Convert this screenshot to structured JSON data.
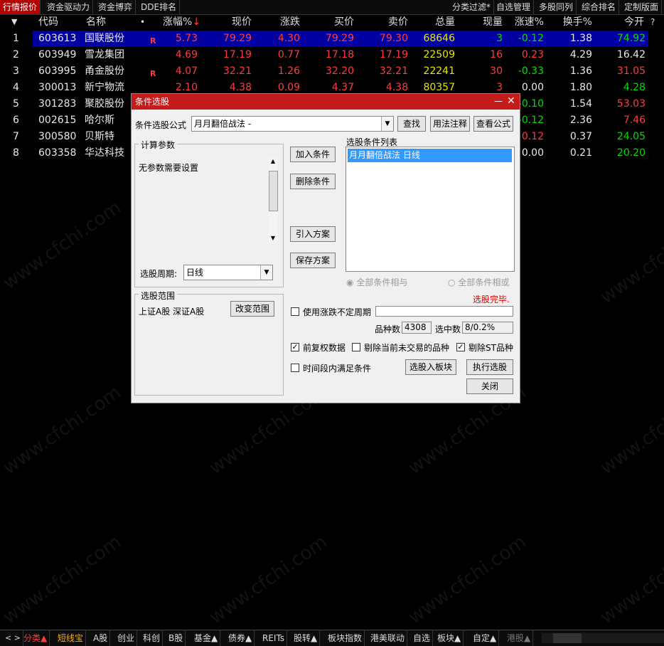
{
  "top_tabs": [
    "行情报价",
    "资金驱动力",
    "资金博弈",
    "DDE排名"
  ],
  "top_right_tabs": [
    "分类过滤*",
    "自选管理",
    "多股同列",
    "综合排名",
    "定制版面"
  ],
  "headers": {
    "arrow": "▼",
    "code": "代码",
    "name": "名称",
    "dot": "•",
    "chg_pct": "涨幅%",
    "chg_arrow": "↓",
    "price": "现价",
    "chg": "涨跌",
    "bid": "买价",
    "ask": "卖价",
    "vol": "总量",
    "cur_vol": "现量",
    "speed": "涨速%",
    "turnover": "换手%",
    "open": "今开",
    "help": "?"
  },
  "rows": [
    {
      "idx": "1",
      "code": "603613",
      "name": "国联股份",
      "flag": "R",
      "chg_pct": "5.73",
      "price": "79.29",
      "chg": "4.30",
      "bid": "79.29",
      "ask": "79.30",
      "vol": "68646",
      "cur_vol": "3",
      "speed": "-0.12",
      "turnover": "1.38",
      "open": "74.92"
    },
    {
      "idx": "2",
      "code": "603949",
      "name": "雪龙集团",
      "flag": "",
      "chg_pct": "4.69",
      "price": "17.19",
      "chg": "0.77",
      "bid": "17.18",
      "ask": "17.19",
      "vol": "22509",
      "cur_vol": "16",
      "speed": "0.23",
      "turnover": "4.29",
      "open": "16.42"
    },
    {
      "idx": "3",
      "code": "603995",
      "name": "甬金股份",
      "flag": "R",
      "chg_pct": "4.07",
      "price": "32.21",
      "chg": "1.26",
      "bid": "32.20",
      "ask": "32.21",
      "vol": "22241",
      "cur_vol": "30",
      "speed": "-0.33",
      "turnover": "1.36",
      "open": "31.05"
    },
    {
      "idx": "4",
      "code": "300013",
      "name": "新宁物流",
      "flag": "",
      "chg_pct": "2.10",
      "price": "4.38",
      "chg": "0.09",
      "bid": "4.37",
      "ask": "4.38",
      "vol": "80357",
      "cur_vol": "3",
      "speed": "0.00",
      "turnover": "1.80",
      "open": "4.28"
    },
    {
      "idx": "5",
      "code": "301283",
      "name": "聚胶股份",
      "flag": "",
      "chg_pct": "",
      "price": "",
      "chg": "",
      "bid": "",
      "ask": "",
      "vol": "",
      "cur_vol": "",
      "speed": "-0.10",
      "turnover": "1.54",
      "open": "53.03"
    },
    {
      "idx": "6",
      "code": "002615",
      "name": "哈尔斯",
      "flag": "",
      "chg_pct": "",
      "price": "",
      "chg": "",
      "bid": "",
      "ask": "",
      "vol": "",
      "cur_vol": "",
      "speed": "-0.12",
      "turnover": "2.36",
      "open": "7.46"
    },
    {
      "idx": "7",
      "code": "300580",
      "name": "贝斯特",
      "flag": "",
      "chg_pct": "",
      "price": "",
      "chg": "",
      "bid": "",
      "ask": "",
      "vol": "",
      "cur_vol": "",
      "speed": "0.12",
      "turnover": "0.37",
      "open": "24.05"
    },
    {
      "idx": "8",
      "code": "603358",
      "name": "华达科技",
      "flag": "",
      "chg_pct": "",
      "price": "",
      "chg": "",
      "bid": "",
      "ask": "",
      "vol": "",
      "cur_vol": "",
      "speed": "0.00",
      "turnover": "0.21",
      "open": "20.20"
    }
  ],
  "dialog": {
    "title": "条件选股",
    "formula_label": "条件选股公式",
    "formula_value": "月月翻倍战法 -",
    "find_btn": "查找",
    "usage_btn": "用法注释",
    "view_btn": "查看公式",
    "params_group": "计算参数",
    "params_text": "无参数需要设置",
    "period_label": "选股周期:",
    "period_value": "日线",
    "add_btn": "加入条件",
    "del_btn": "删除条件",
    "import_btn": "引入方案",
    "save_btn": "保存方案",
    "cond_list_label": "选股条件列表",
    "cond_items": [
      "月月翻倍战法  日线"
    ],
    "radio_and": "全部条件相与",
    "radio_or": "全部条件相或",
    "status": "选股完毕.",
    "range_group": "选股范围",
    "range_text": "上证A股 深证A股",
    "change_range_btn": "改变范围",
    "use_period_label": "使用涨跌不定周期",
    "count_label": "品种数",
    "count_value": "4308",
    "selected_label": "选中数",
    "selected_value": "8/0.2%",
    "prev_adj_label": "前复权数据",
    "exclude_untraded_label": "剔除当前未交易的品种",
    "exclude_st_label": "剔除ST品种",
    "time_range_label": "时间段内满足条件",
    "to_block_btn": "选股入板块",
    "execute_btn": "执行选股",
    "close_btn": "关闭"
  },
  "bottom_tabs": [
    "分类▲",
    "短线宝",
    "A股",
    "创业",
    "科创",
    "B股",
    "基金▲",
    "债券▲",
    "REITs",
    "股转▲",
    "板块指数",
    "港美联动",
    "自选",
    "板块▲",
    "自定▲",
    "港股▲"
  ],
  "watermark": "www.cfchi.com",
  "colors": {
    "up": "#ff3c3c",
    "down": "#00e000",
    "selected_row": "#0000a0",
    "dialog_title": "#c41c1c"
  }
}
